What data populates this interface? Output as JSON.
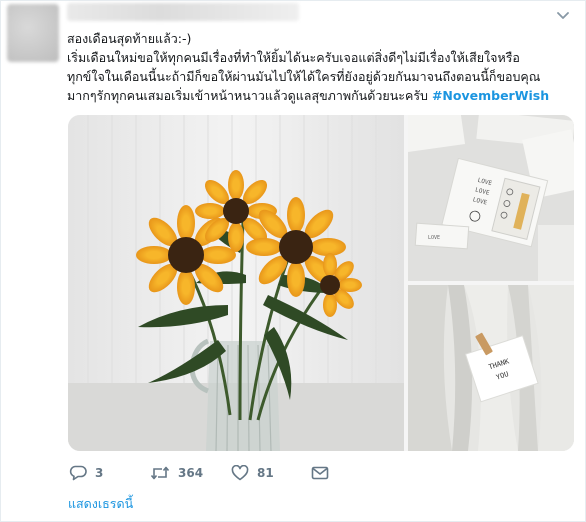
{
  "tweet": {
    "lines": [
      "สองเดือนสุดท้ายแล้ว:-)",
      "เริ่มเดือนใหม่ขอให้ทุกคนมีเรื่องที่ทำให้ยิ้มได้นะครับเจอแต่สิ่งดีๆไม่มีเรื่องให้เสียใจหรือ",
      "ทุกข์ใจในเดือนนี้นะถ้ามีก็ขอให้ผ่านมันไปให้ได้ใครที่ยังอยู่ด้วยกันมาจนถึงตอนนี้ก็ขอบคุณ",
      "มากๆรักทุกคนเสมอเริ่มเข้าหน้าหนาวแล้วดูแลสุขภาพกันด้วยนะครับ"
    ],
    "hashtag": "#NovemberWish"
  },
  "media": {
    "photos": [
      "sunflowers-in-vase",
      "white-cards",
      "note-on-curtain"
    ],
    "card_text": [
      "LOVE",
      "LOVE",
      "LOVE"
    ],
    "small_card_text": "LOVE",
    "note_text": [
      "THANK",
      "YOU"
    ]
  },
  "actions": {
    "reply_count": "3",
    "retweet_count": "364",
    "like_count": "81"
  },
  "show_thread_label": "แสดงเธรดนี้",
  "colors": {
    "link": "#1b95e0",
    "icon": "#657786",
    "text": "#14171a",
    "sunflower_petal": "#f0a91e",
    "sunflower_center": "#3a2412",
    "leaf": "#2f4a25"
  }
}
